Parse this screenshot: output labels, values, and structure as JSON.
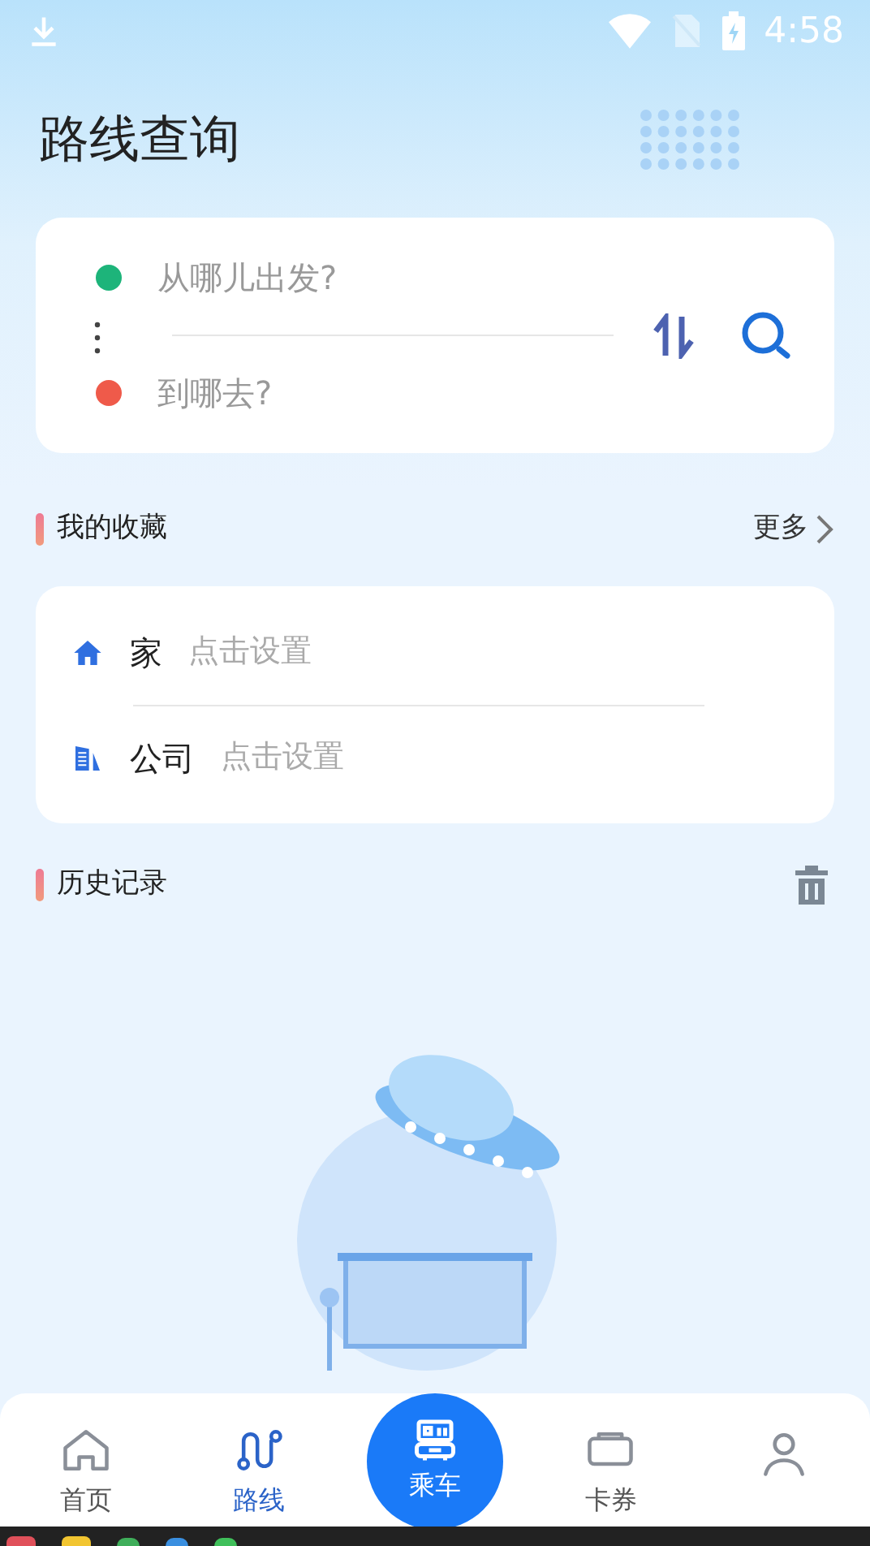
{
  "status_bar": {
    "time": "4:58"
  },
  "title": "路线查询",
  "route_search": {
    "from": {
      "placeholder": "从哪儿出发?",
      "color": "#1db47a"
    },
    "to": {
      "placeholder": "到哪去?",
      "color": "#ef5a4a"
    }
  },
  "favorites": {
    "title": "我的收藏",
    "more": "更多",
    "items": [
      {
        "kind": "home",
        "name": "家",
        "hint": "点击设置"
      },
      {
        "kind": "office",
        "name": "公司",
        "hint": "点击设置"
      }
    ]
  },
  "history": {
    "title": "历史记录"
  },
  "bottom_nav": [
    {
      "kind": "home",
      "label": "首页",
      "selected": false
    },
    {
      "kind": "route",
      "label": "路线",
      "selected": true
    },
    {
      "kind": "ride",
      "label": "乘车",
      "selected": false
    },
    {
      "kind": "card",
      "label": "卡券",
      "selected": false
    },
    {
      "kind": "profile",
      "selected": false
    }
  ]
}
